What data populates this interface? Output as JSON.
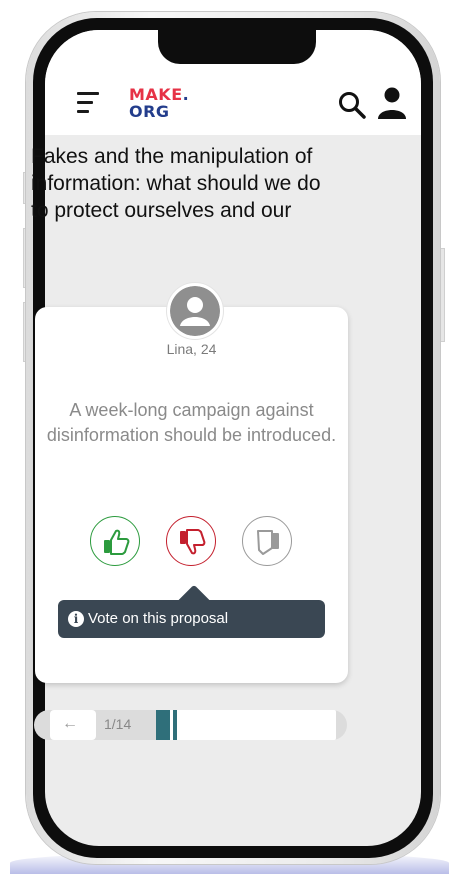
{
  "header": {
    "logo_line1": "MAKE",
    "logo_dot": ".",
    "logo_line2": "ORG",
    "menu_icon": "hamburger-menu-icon",
    "search_icon": "search-icon",
    "user_icon": "user-icon"
  },
  "consultation": {
    "question": "Fakes and the manipulation of information: what should we do to protect ourselves and our"
  },
  "proposal": {
    "author": "Lina, 24",
    "text": "A week-long campaign against disinformation should be introduced.",
    "avatar_icon": "user-avatar-icon"
  },
  "votes": [
    {
      "id": "agree",
      "icon": "thumbs-up-icon",
      "color": "#2c9b3e"
    },
    {
      "id": "disagree",
      "icon": "thumbs-down-icon",
      "color": "#c4202e"
    },
    {
      "id": "neutral",
      "icon": "neutral-hand-icon",
      "color": "#9a9a9a"
    }
  ],
  "tooltip": {
    "text": "Vote on this proposal",
    "icon": "info-icon"
  },
  "pager": {
    "prev_symbol": "←",
    "counter": "1/14",
    "current": 1,
    "total": 14,
    "progress_fraction": 0.0714
  },
  "colors": {
    "accent": "#2f6f7a",
    "tooltip_bg": "#3a4753",
    "brand_red": "#e63246",
    "brand_blue": "#233d8c"
  }
}
